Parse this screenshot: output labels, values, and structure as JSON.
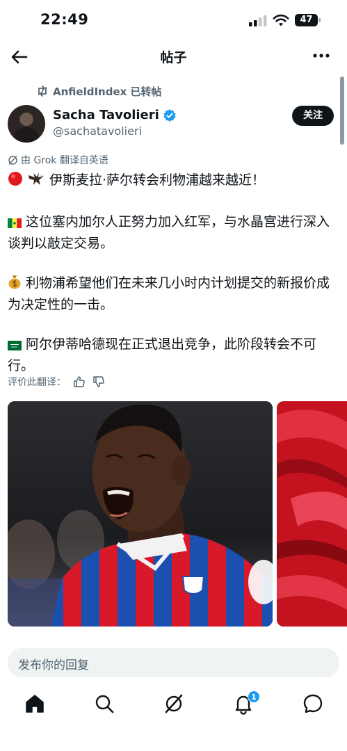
{
  "status_bar": {
    "time": "22:49",
    "battery": "47"
  },
  "header": {
    "title": "帖子"
  },
  "repost": {
    "text": "AnfieldIndex 已转帖"
  },
  "author": {
    "name": "Sacha Tavolieri",
    "handle": "@sachatavolieri",
    "verified": true
  },
  "follow_label": "关注",
  "translation_note": "由 Grok 翻译自英语",
  "tweet": {
    "line1": "伊斯麦拉·萨尔转会利物浦越来越近！",
    "line2": "这位塞内加尔人正努力加入红军，与水晶宫进行深入谈判以敲定交易。",
    "line3": "利物浦希望他们在未来几小时内计划提交的新报价成为决定性的一击。",
    "line4": "阿尔伊蒂哈德现在正式退出竞争，此阶段转会不可行。"
  },
  "rate_label": "评价此翻译：",
  "reply_placeholder": "发布你的回复",
  "notifications_count": "1",
  "icons": {
    "back": "arrow-left-icon",
    "more": "more-dots-icon",
    "repost": "repost-icon",
    "verified": "verified-badge-icon",
    "grok": "grok-icon",
    "thumbs_up": "thumbs-up-icon",
    "thumbs_down": "thumbs-down-icon",
    "home": "home-icon",
    "search": "search-icon",
    "grok_tab": "grok-icon",
    "notifications": "bell-icon",
    "messages": "messages-icon"
  },
  "colors": {
    "accent": "#1d9bf0",
    "text": "#0f1419",
    "secondary_text": "#536471",
    "liverpool_red": "#d71920"
  }
}
